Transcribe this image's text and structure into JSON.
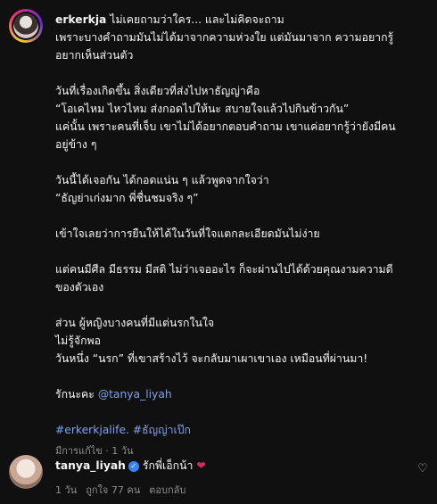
{
  "post": {
    "username": "erkerkja",
    "lines": [
      " ไม่เคยถามว่าใคร... และไม่คิดจะถาม",
      "เพราะบางคำถามมันไม่ได้มาจากความห่วงใย แต่มันมาจาก ความอยากรู้",
      "อยากเห็นส่วนตัว",
      "",
      "วันที่เรื่องเกิดขึ้น สิ่งเดียวที่ส่งไปหาธัญญ่าคือ",
      "“โอเคไหม ไหวไหม ส่งกอดไปให้นะ สบายใจแล้วไปกินข้าวกัน”",
      "แค่นั้น เพราะคนที่เจ็บ เขาไม่ได้อยากตอบคำถาม เขาแค่อยากรู้ว่ายังมีคน",
      "อยู่ข้าง ๆ",
      "",
      "วันนี้ได้เจอกัน ได้กอดแน่น ๆ แล้วพูดจากใจว่า",
      "“ธัญย่าเก่งมาก พี่ชื่นชมจริง ๆ”",
      "",
      "เข้าใจเลยว่าการยืนให้ได้ในวันที่ใจแตกละเอียดมันไม่ง่าย",
      "",
      "แต่คนมีศีล มีธรรม มีสติ ไม่ว่าเจออะไร ก็จะผ่านไปได้ด้วยคุณงามความดี",
      "ของตัวเอง",
      "",
      "ส่วน ผู้หญิงบางคนที่มีแต่นรกในใจ",
      "ไม่รู้จักพอ",
      "วันหนึ่ง “นรก” ที่เขาสร้างไว้ จะกลับมาเผาเขาเอง เหมือนที่ผ่านมา!",
      "",
      "รักนะคะ "
    ],
    "mention": "@tanya_liyah",
    "hashtags": "#erkerkjalife. #ธัญญ่าเป๊ก",
    "meta": "มีการแก้ไข · 1 วัน"
  },
  "reply": {
    "username": "tanya_liyah",
    "text": "รักพี่เอ็กน้า",
    "age": "1 วัน",
    "likes": "ถูกใจ 77 คน",
    "reply_label": "ตอบกลับ"
  },
  "icons": {
    "verified": "verified-badge-icon",
    "heart": "heart-emoji-icon",
    "like": "heart-outline-icon"
  },
  "colors": {
    "background": "#101010",
    "link": "#7fa3e6",
    "verified": "#3b82f6",
    "heart": "#e0245e"
  }
}
